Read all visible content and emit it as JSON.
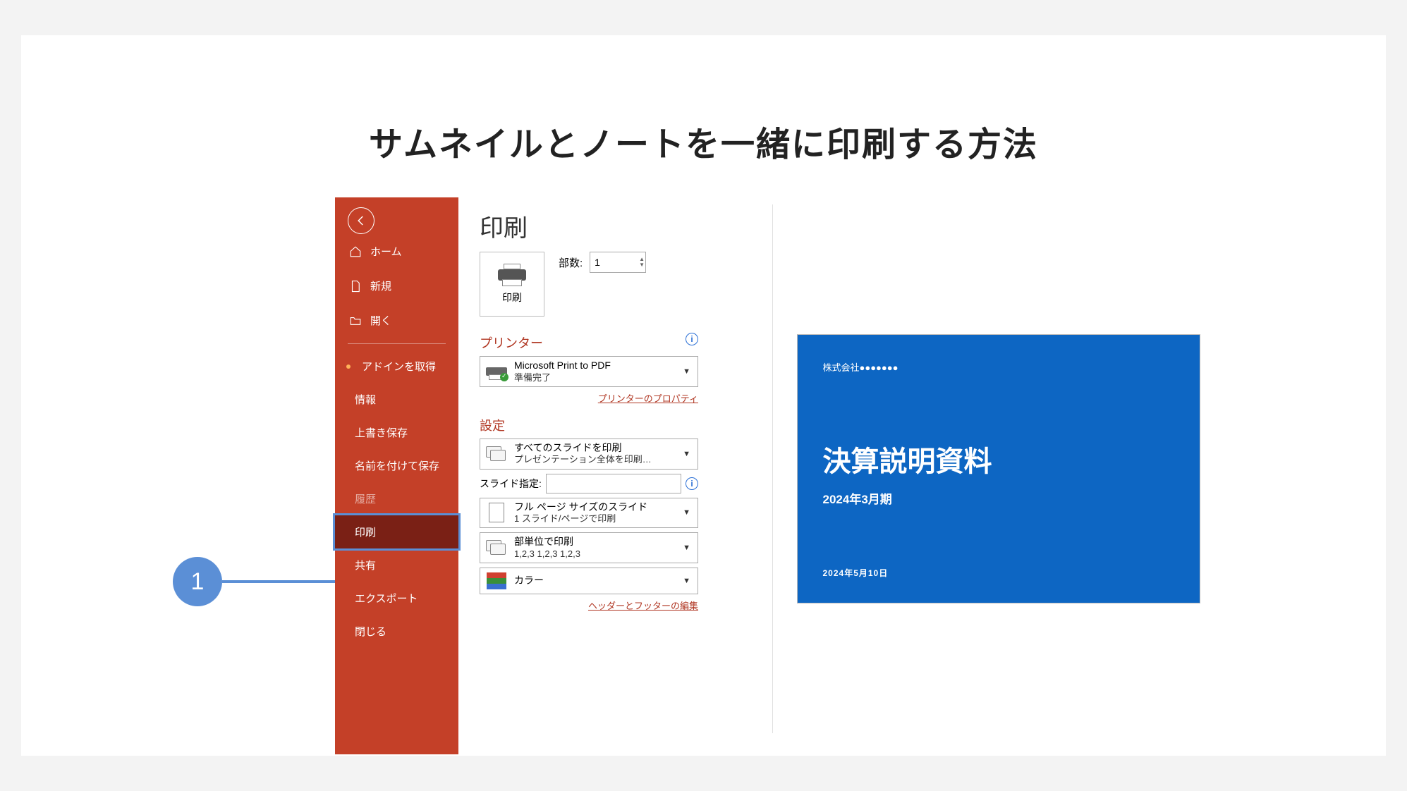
{
  "page_title": "サムネイルとノートを一緒に印刷する方法",
  "callout_number": "1",
  "sidebar": {
    "home": "ホーム",
    "new": "新規",
    "open": "開く",
    "addin": "アドインを取得",
    "info": "情報",
    "save": "上書き保存",
    "saveas": "名前を付けて保存",
    "history": "履歴",
    "print": "印刷",
    "share": "共有",
    "export": "エクスポート",
    "close": "閉じる"
  },
  "main": {
    "title": "印刷",
    "print_button": "印刷",
    "copies_label": "部数:",
    "copies_value": "1",
    "printer_header": "プリンター",
    "printer_name": "Microsoft Print to PDF",
    "printer_status": "準備完了",
    "printer_props_link": "プリンターのプロパティ",
    "settings_header": "設定",
    "slides_all_line1": "すべてのスライドを印刷",
    "slides_all_line2": "プレゼンテーション全体を印刷…",
    "slide_spec_label": "スライド指定:",
    "layout_line1": "フル ページ サイズのスライド",
    "layout_line2": "1 スライド/ページで印刷",
    "collate_line1": "部単位で印刷",
    "collate_line2": "1,2,3   1,2,3   1,2,3",
    "color_label": "カラー",
    "header_footer_link": "ヘッダーとフッターの編集"
  },
  "preview": {
    "company": "株式会社●●●●●●●",
    "title": "決算説明資料",
    "period": "2024年3月期",
    "date": "2024年5月10日"
  }
}
